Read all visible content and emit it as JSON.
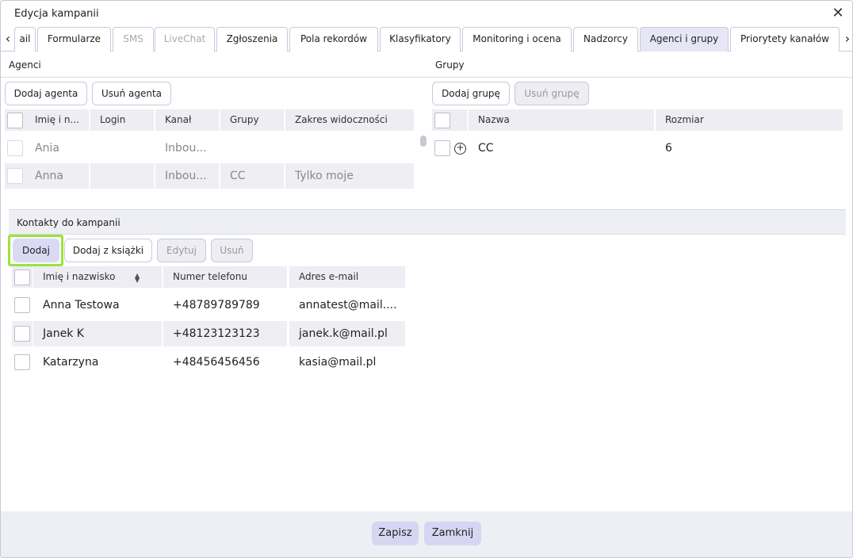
{
  "window": {
    "title": "Edycja kampanii"
  },
  "tabs": [
    {
      "label": "ail"
    },
    {
      "label": "Formularze"
    },
    {
      "label": "SMS"
    },
    {
      "label": "LiveChat"
    },
    {
      "label": "Zgłoszenia"
    },
    {
      "label": "Pola rekordów"
    },
    {
      "label": "Klasyfikatory"
    },
    {
      "label": "Monitoring i ocena"
    },
    {
      "label": "Nadzorcy"
    },
    {
      "label": "Agenci i grupy"
    },
    {
      "label": "Priorytety kanałów"
    }
  ],
  "agents": {
    "header": "Agenci",
    "add_button": "Dodaj agenta",
    "remove_button": "Usuń agenta",
    "columns": [
      "Imię i n...",
      "Login",
      "Kanał",
      "Grupy",
      "Zakres widoczności"
    ],
    "rows": [
      {
        "name": "Ania",
        "login": "",
        "channel": "Inbou...",
        "groups": "",
        "scope": ""
      },
      {
        "name": "Anna",
        "login": "",
        "channel": "Inbou...",
        "groups": "CC",
        "scope": "Tylko moje"
      }
    ]
  },
  "groups": {
    "header": "Grupy",
    "add_button": "Dodaj grupę",
    "remove_button": "Usuń grupę",
    "columns": [
      "Nazwa",
      "Rozmiar"
    ],
    "rows": [
      {
        "name": "CC",
        "size": "6"
      }
    ]
  },
  "contacts": {
    "header": "Kontakty do kampanii",
    "add_button": "Dodaj",
    "add_from_book_button": "Dodaj z książki",
    "edit_button": "Edytuj",
    "delete_button": "Usuń",
    "columns": [
      "Imię i nazwisko",
      "Numer telefonu",
      "Adres e-mail"
    ],
    "rows": [
      {
        "name": "Anna Testowa",
        "phone": "+48789789789",
        "email": "annatest@mail...."
      },
      {
        "name": "Janek K",
        "phone": "+48123123123",
        "email": "janek.k@mail.pl"
      },
      {
        "name": "Katarzyna",
        "phone": "+48456456456",
        "email": "kasia@mail.pl"
      }
    ]
  },
  "footer": {
    "save_button": "Zapisz",
    "close_button": "Zamknij"
  },
  "colors": {
    "accent_highlight": "#9be33c",
    "active_tab": "#e6e6f5",
    "primary_button": "#d6d6f2"
  }
}
